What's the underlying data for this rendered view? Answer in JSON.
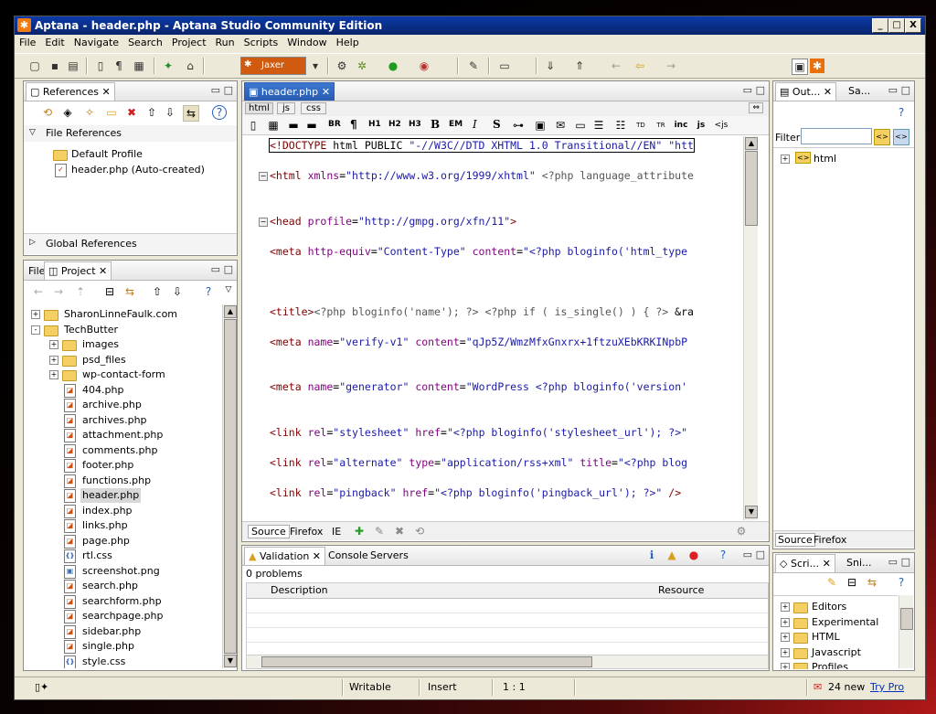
{
  "window": {
    "title": "Aptana - header.php - Aptana Studio Community Edition",
    "controls": [
      "_",
      "□",
      "X"
    ]
  },
  "menu": [
    "File",
    "Edit",
    "Navigate",
    "Search",
    "Project",
    "Run",
    "Scripts",
    "Window",
    "Help"
  ],
  "toolbar": {
    "jaxer_label": "Jaxer"
  },
  "references": {
    "tab": "References",
    "file_references": "File References",
    "items": [
      "Default Profile",
      "header.php (Auto-created)"
    ],
    "global_references": "Global References"
  },
  "project": {
    "tabs": [
      "File",
      "Project"
    ],
    "tree": [
      {
        "label": "SharonLinneFaulk.com",
        "type": "project",
        "depth": 0,
        "expander": "+"
      },
      {
        "label": "TechButter",
        "type": "project",
        "depth": 0,
        "expander": "-"
      },
      {
        "label": "images",
        "type": "folder",
        "depth": 1,
        "expander": "+"
      },
      {
        "label": "psd_files",
        "type": "folder",
        "depth": 1,
        "expander": "+"
      },
      {
        "label": "wp-contact-form",
        "type": "folder",
        "depth": 1,
        "expander": "+"
      },
      {
        "label": "404.php",
        "type": "php",
        "depth": 1
      },
      {
        "label": "archive.php",
        "type": "php",
        "depth": 1
      },
      {
        "label": "archives.php",
        "type": "php",
        "depth": 1
      },
      {
        "label": "attachment.php",
        "type": "php",
        "depth": 1
      },
      {
        "label": "comments.php",
        "type": "php",
        "depth": 1
      },
      {
        "label": "footer.php",
        "type": "php",
        "depth": 1
      },
      {
        "label": "functions.php",
        "type": "php",
        "depth": 1
      },
      {
        "label": "header.php",
        "type": "php",
        "depth": 1,
        "selected": true
      },
      {
        "label": "index.php",
        "type": "php",
        "depth": 1
      },
      {
        "label": "links.php",
        "type": "php",
        "depth": 1
      },
      {
        "label": "page.php",
        "type": "php",
        "depth": 1
      },
      {
        "label": "rtl.css",
        "type": "css",
        "depth": 1
      },
      {
        "label": "screenshot.png",
        "type": "png",
        "depth": 1
      },
      {
        "label": "search.php",
        "type": "php",
        "depth": 1
      },
      {
        "label": "searchform.php",
        "type": "php",
        "depth": 1
      },
      {
        "label": "searchpage.php",
        "type": "php",
        "depth": 1
      },
      {
        "label": "sidebar.php",
        "type": "php",
        "depth": 1
      },
      {
        "label": "single.php",
        "type": "php",
        "depth": 1
      },
      {
        "label": "style.css",
        "type": "css",
        "depth": 1
      }
    ]
  },
  "editor": {
    "tab": "header.php",
    "lang_tabs": [
      "html",
      "js",
      "css"
    ],
    "format_buttons": [
      "BR",
      "¶",
      "H1",
      "H2",
      "H3",
      "B",
      "EM",
      "I",
      "S"
    ],
    "lines": [
      {
        "text": "<!DOCTYPE html PUBLIC \"-//W3C//DTD XHTML 1.0 Transitional//EN\" \"htt",
        "fold": false
      },
      {
        "text": "",
        "fold": false
      },
      {
        "text": "<html xmlns=\"http://www.w3.org/1999/xhtml\" <?php language_attribute",
        "fold": true
      },
      {
        "text": "",
        "fold": false
      },
      {
        "text": "",
        "fold": false
      },
      {
        "text": "<head profile=\"http://gmpg.org/xfn/11\">",
        "fold": true
      },
      {
        "text": "",
        "fold": false
      },
      {
        "text": "<meta http-equiv=\"Content-Type\" content=\"<?php bloginfo('html_type",
        "fold": false
      },
      {
        "text": "",
        "fold": false
      },
      {
        "text": "",
        "fold": false
      },
      {
        "text": "",
        "fold": false
      },
      {
        "text": "<title><?php bloginfo('name'); ?> <?php if ( is_single() ) { ?> &ra",
        "fold": false
      },
      {
        "text": "",
        "fold": false
      },
      {
        "text": "<meta name=\"verify-v1\" content=\"qJp5Z/WmzMfxGnxrx+1ftzuXEbKRKINpbP",
        "fold": false
      },
      {
        "text": "",
        "fold": false
      },
      {
        "text": "",
        "fold": false
      },
      {
        "text": "<meta name=\"generator\" content=\"WordPress <?php bloginfo('version'",
        "fold": false
      },
      {
        "text": "",
        "fold": false
      },
      {
        "text": "",
        "fold": false
      },
      {
        "text": "<link rel=\"stylesheet\" href=\"<?php bloginfo('stylesheet_url'); ?>\"",
        "fold": false
      },
      {
        "text": "",
        "fold": false
      },
      {
        "text": "<link rel=\"alternate\" type=\"application/rss+xml\" title=\"<?php blog",
        "fold": false
      },
      {
        "text": "",
        "fold": false
      },
      {
        "text": "<link rel=\"pingback\" href=\"<?php bloginfo('pingback_url'); ?>\" />",
        "fold": false
      }
    ],
    "bottom_tabs": [
      "Source",
      "Firefox",
      "IE"
    ]
  },
  "validation": {
    "tabs": [
      "Validation",
      "Console",
      "Servers"
    ],
    "summary": "0 problems",
    "columns": [
      "Description",
      "Resource"
    ]
  },
  "outline": {
    "tabs": [
      "Out...",
      "Sa..."
    ],
    "filter_label": "Filter:",
    "items": [
      "html"
    ],
    "bottom_tabs": [
      "Source",
      "Firefox"
    ]
  },
  "scripts": {
    "tabs": [
      "Scri...",
      "Sni..."
    ],
    "items": [
      "Editors",
      "Experimental",
      "HTML",
      "Javascript",
      "Profiles"
    ]
  },
  "status": {
    "mode": "Writable",
    "insert": "Insert",
    "position": "1 : 1",
    "news": "24 new",
    "try_pro": "Try Pro"
  },
  "colors": {
    "title_bar": "#0a246a",
    "accent_orange": "#e8700d",
    "tag": "#800000",
    "attr": "#7f007f",
    "string": "#1a1aa6"
  }
}
